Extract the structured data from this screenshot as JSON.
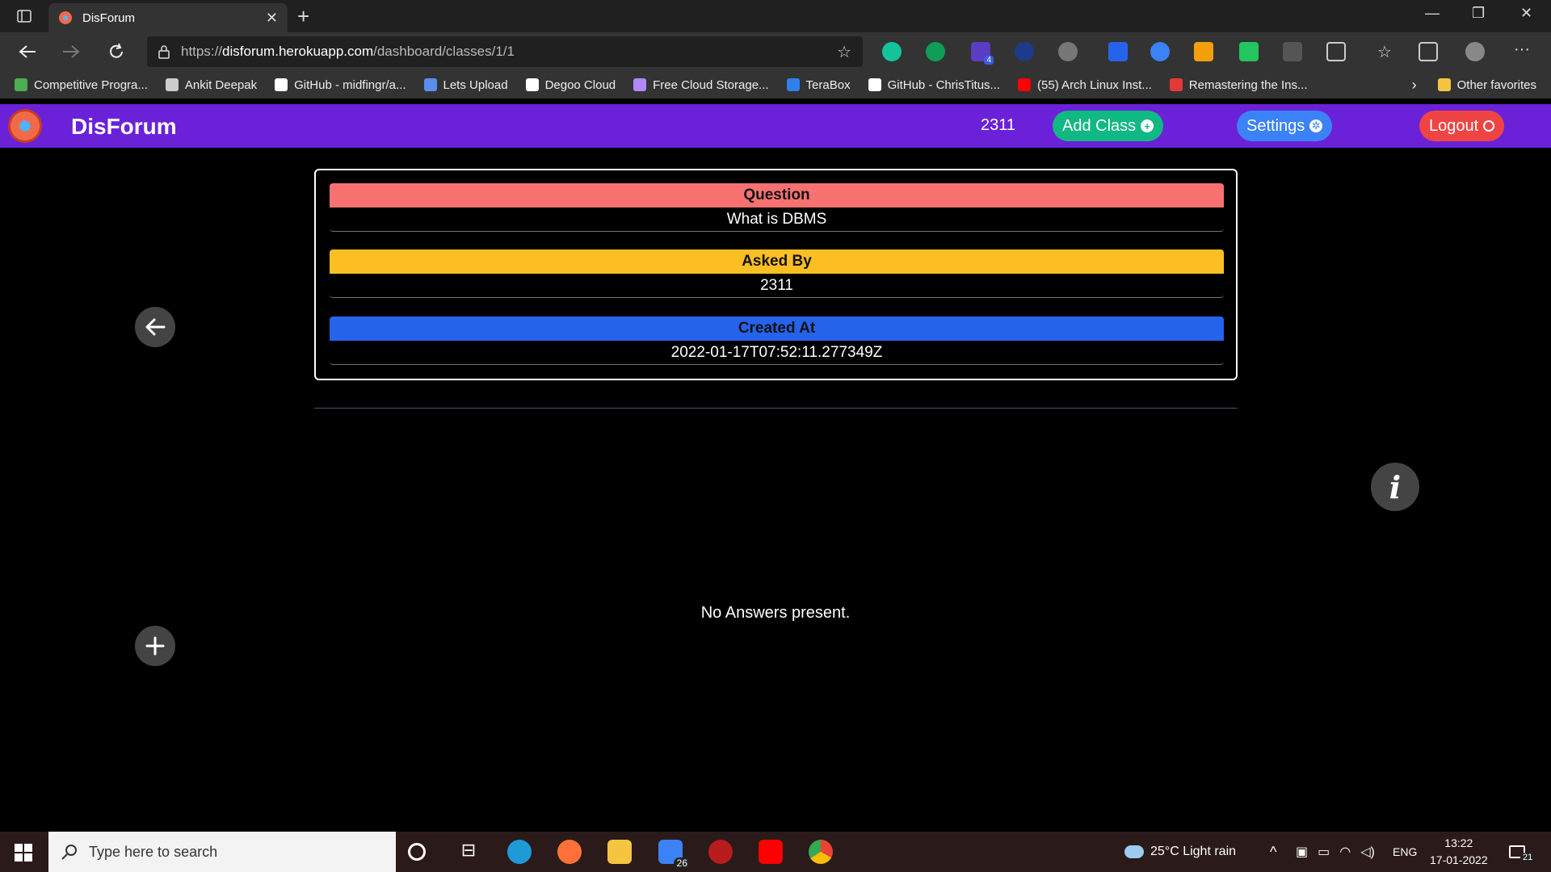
{
  "browser": {
    "tab_title": "DisForum",
    "url_prefix": "https://",
    "url_host": "disforum.herokuapp.com",
    "url_path": "/dashboard/classes/1/1",
    "bookmarks": [
      {
        "label": "Competitive Progra...",
        "color": "#4caf50"
      },
      {
        "label": "Ankit Deepak",
        "color": "#cccccc"
      },
      {
        "label": "GitHub - midfingr/a...",
        "color": "#ffffff"
      },
      {
        "label": "Lets Upload",
        "color": "#5b8def"
      },
      {
        "label": "Degoo Cloud",
        "color": "#ffffff"
      },
      {
        "label": "Free Cloud Storage...",
        "color": "#b388ff"
      },
      {
        "label": "TeraBox",
        "color": "#2f80ed"
      },
      {
        "label": "GitHub - ChrisTitus...",
        "color": "#ffffff"
      },
      {
        "label": "(55) Arch Linux Inst...",
        "color": "#ff0000"
      },
      {
        "label": "Remastering the Ins...",
        "color": "#e53935"
      }
    ],
    "other_favorites": "Other favorites",
    "extension_badge": "4"
  },
  "app": {
    "brand": "DisForum",
    "username": "2311",
    "add_class_label": "Add Class",
    "settings_label": "Settings",
    "logout_label": "Logout",
    "colors": {
      "nav": "#6b21d8",
      "add_class": "#10b981",
      "settings": "#3b82f6",
      "logout": "#ef4444",
      "question_header": "#f87171",
      "asked_by_header": "#fbbf24",
      "created_at_header": "#2563eb"
    }
  },
  "question_card": {
    "question_heading": "Question",
    "question_value": "What is DBMS",
    "asked_by_heading": "Asked By",
    "asked_by_value": "2311",
    "created_at_heading": "Created At",
    "created_at_value": "2022-01-17T07:52:11.277349Z"
  },
  "answers": {
    "empty_message": "No Answers present."
  },
  "icons": {
    "back": "arrow-left-icon",
    "add": "plus-icon",
    "info": "info-icon"
  },
  "taskbar": {
    "search_placeholder": "Type here to search",
    "mail_badge": "26",
    "weather": "25°C  Light rain",
    "language": "ENG",
    "time": "13:22",
    "date": "17-01-2022",
    "notifications": "21"
  }
}
